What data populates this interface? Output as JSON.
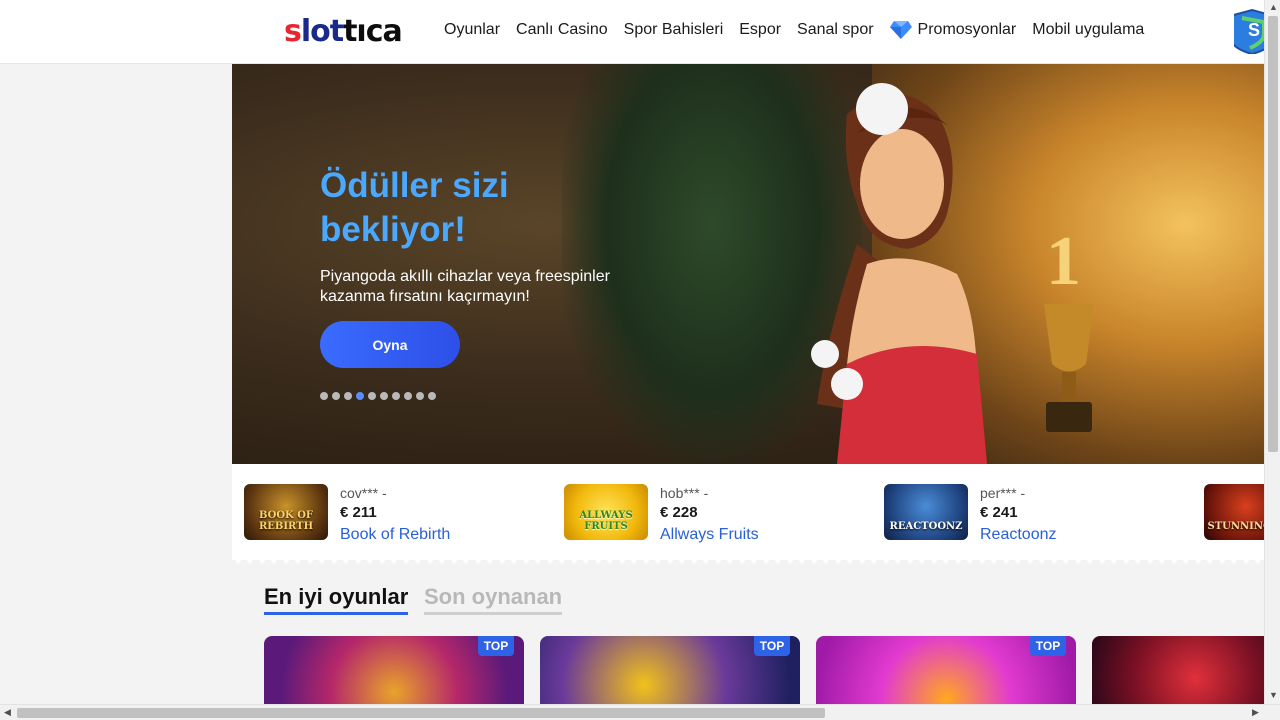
{
  "header": {
    "logo": {
      "s": "s",
      "lot": "lot",
      "tica": "tıca"
    },
    "nav": [
      {
        "label": "Oyunlar"
      },
      {
        "label": "Canlı Casino"
      },
      {
        "label": "Spor Bahisleri"
      },
      {
        "label": "Espor"
      },
      {
        "label": "Sanal spor"
      },
      {
        "label": "Promosyonlar",
        "icon": "diamond-icon"
      },
      {
        "label": "Mobil uygulama"
      }
    ]
  },
  "hero": {
    "title": "Ödüller sizi bekliyor!",
    "subtitle": "Piyangoda akıllı cihazlar veya freespinler kazanma fırsatını kaçırmayın!",
    "button": "Oyna",
    "slides_total": 10,
    "active_slide": 4
  },
  "winners": [
    {
      "user": "cov*** -",
      "amount": "€ 211",
      "game": "Book of Rebirth",
      "thumb_text": "BOOK OF REBIRTH"
    },
    {
      "user": "hob*** -",
      "amount": "€ 228",
      "game": "Allways Fruits",
      "thumb_text": "ALLWAYS FRUITS"
    },
    {
      "user": "per*** -",
      "amount": "€ 241",
      "game": "Reactoonz",
      "thumb_text": "REACTOONZ"
    },
    {
      "user": "",
      "amount": "",
      "game": "",
      "thumb_text": "STUNNING H"
    }
  ],
  "tabs": {
    "active": "En iyi oyunlar",
    "inactive": "Son oynanan"
  },
  "cards": [
    {
      "badge": "TOP"
    },
    {
      "badge": "TOP"
    },
    {
      "badge": "TOP"
    },
    {
      "badge": ""
    }
  ],
  "colors": {
    "accent": "#2e63e8",
    "title_blue": "#4aa8ff",
    "link_blue": "#2860d8"
  }
}
